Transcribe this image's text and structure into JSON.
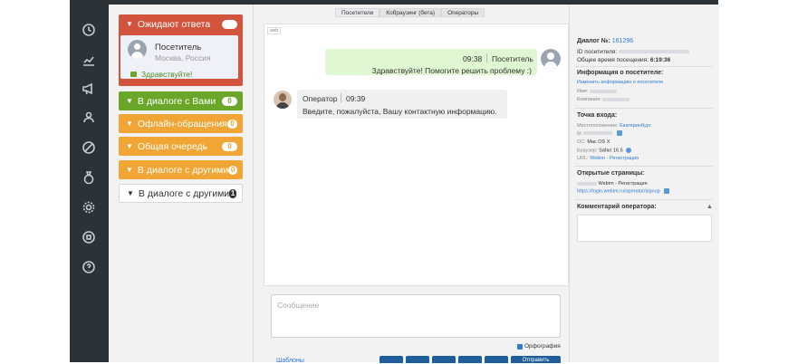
{
  "sidebar": {
    "icons": [
      "history-icon",
      "chart-icon",
      "megaphone-icon",
      "users-icon",
      "ban-icon",
      "money-bag-icon",
      "settings-icon",
      "stop-icon",
      "help-icon"
    ]
  },
  "queue": {
    "items": [
      {
        "label": "Ожидают ответа",
        "count": "1",
        "color": "#d2543d"
      },
      {
        "label": "В диалоге с Вами",
        "count": "0",
        "color": "#6aa728"
      },
      {
        "label": "Офлайн-обращения",
        "count": "0",
        "color": "#f0a534"
      },
      {
        "label": "Общая очередь",
        "count": "0",
        "color": "#f0a534"
      },
      {
        "label": "В диалоге с другими",
        "count": "0",
        "color": "#f0a534"
      },
      {
        "label": "В диалоге с другими",
        "count": "1",
        "color": "#ffffff"
      }
    ],
    "visitor_card": {
      "name": "Посетитель",
      "location": "Москва, Россия",
      "message": "Здравствуйте!"
    }
  },
  "tabs": [
    "Посетители",
    "Кобраузинг (бета)",
    "Операторы"
  ],
  "chat": {
    "mini_label": "web",
    "visitor_msg": {
      "time": "09:38",
      "name": "Посетитель",
      "text": "Здравствуйте! Помогите решить проблему :)"
    },
    "operator_msg": {
      "name": "Оператор",
      "time": "09:39",
      "text": "Введите, пожалуйста, Вашу контактную информацию."
    }
  },
  "composer": {
    "placeholder": "Сообщение",
    "spellcheck_label": "Орфография",
    "bottom_link": "Шаблоны",
    "send_label": "Отправить"
  },
  "right": {
    "dialog_label": "Диалог №:",
    "dialog_id": "161296",
    "visitor_id_label": "ID посетителя:",
    "total_time_label": "Общее время посещения:",
    "total_time": "6:19:36",
    "visitor_info_title": "Информация о посетителе:",
    "change_info_link": "Изменить информацию о посетителе",
    "name_label": "Имя:",
    "company_label": "Компания:",
    "entry_title": "Точка входа:",
    "location_label": "Местоположение:",
    "location_value": "Екатеринбург",
    "ip_label": "ip:",
    "os_label": "ОС:",
    "os_value": "Mac OS X",
    "browser_label": "Браузер:",
    "browser_value": "Safari 16.5",
    "url_label": "URL:",
    "url_value": "Webim - Регистрация",
    "pages_title": "Открытые страницы:",
    "page_title": "Webim - Регистрация",
    "page_url": "https://login.webim.ru/operator/signup",
    "comment_title": "Комментарий оператора:"
  }
}
